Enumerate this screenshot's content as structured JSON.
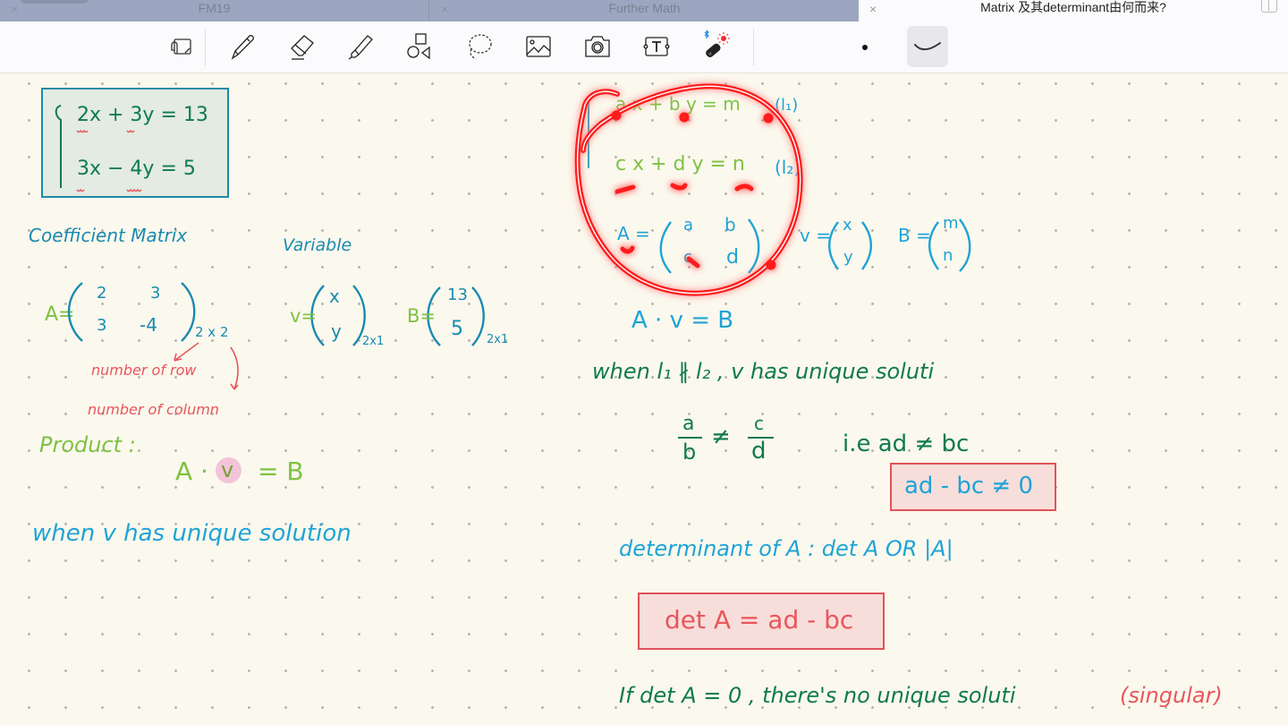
{
  "tabs": [
    {
      "label": "FM19",
      "active": false,
      "close_icon": "×"
    },
    {
      "label": "Further Math",
      "active": false,
      "close_icon": "×"
    },
    {
      "label": "Matrix 及其determinant由何而来?",
      "active": true,
      "close_icon": "×"
    }
  ],
  "toolbar": {
    "tools": [
      {
        "name": "read-only-mode",
        "icon": "text-view-icon"
      },
      {
        "name": "pen",
        "icon": "pen-icon"
      },
      {
        "name": "eraser",
        "icon": "eraser-icon"
      },
      {
        "name": "highlighter",
        "icon": "highlighter-icon"
      },
      {
        "name": "shapes",
        "icon": "shapes-icon"
      },
      {
        "name": "lasso",
        "icon": "lasso-icon"
      },
      {
        "name": "image",
        "icon": "image-icon"
      },
      {
        "name": "camera",
        "icon": "camera-icon"
      },
      {
        "name": "text",
        "icon": "text-box-icon"
      },
      {
        "name": "laser-pointer",
        "icon": "laser-pointer-icon",
        "status": "bluetooth"
      }
    ],
    "stroke_width": "thin-dot",
    "stroke_style": "pressure-curve",
    "colors": {
      "laser_dot": "#f02a2a",
      "bluetooth": "#1e88e5"
    }
  },
  "notes": {
    "system": {
      "line1": "2x + 3y = 13",
      "line2": "3x − 4y = 5"
    },
    "labels": {
      "coefficient_matrix": "Coefficient  Matrix",
      "variable": "Variable"
    },
    "matrix_A": {
      "name": "A=",
      "cells": [
        "2",
        "3",
        "3",
        "-4"
      ],
      "dim": "2 x 2"
    },
    "vector_v": {
      "name": "v=",
      "cells": [
        "x",
        "y"
      ],
      "dim": "2x1"
    },
    "vector_B": {
      "name": "B=",
      "cells": [
        "13",
        "5"
      ],
      "dim": "2x1"
    },
    "annotations": {
      "rows": "number of row",
      "cols": "number of column"
    },
    "product": {
      "label": "Product :",
      "expr_A": "A ·",
      "expr_v": "v",
      "expr_B": "= B"
    },
    "when_unique_left": "when  v has  unique  solution",
    "general": {
      "l1": "a x + b y = m",
      "l1_tag": "(l₁)",
      "l2": "c x + d y = n",
      "l2_tag": "(l₂)",
      "A_name": "A =",
      "A_cells": [
        "a",
        "b",
        "c",
        "d"
      ],
      "v_name": "v =",
      "v_cells": [
        "x",
        "y"
      ],
      "B_name": "B =",
      "B_cells": [
        "m",
        "n"
      ],
      "equation": "A · v = B"
    },
    "right": {
      "when_line": "when  l₁ ∦ l₂   , v has  unique  soluti",
      "frac_a": "a",
      "frac_b": "b",
      "neq": "≠",
      "frac_c": "c",
      "frac_d": "d",
      "ie": "i.e  ad ≠ bc",
      "boxed_ineq": "ad - bc ≠ 0",
      "determinant_line": "determinant  of  A :  det A   OR  |A|",
      "det_formula": "det A = ad - bc",
      "if_line": "If   det A = 0  ,  there's  no  unique  soluti",
      "singular": "(singular)"
    }
  }
}
